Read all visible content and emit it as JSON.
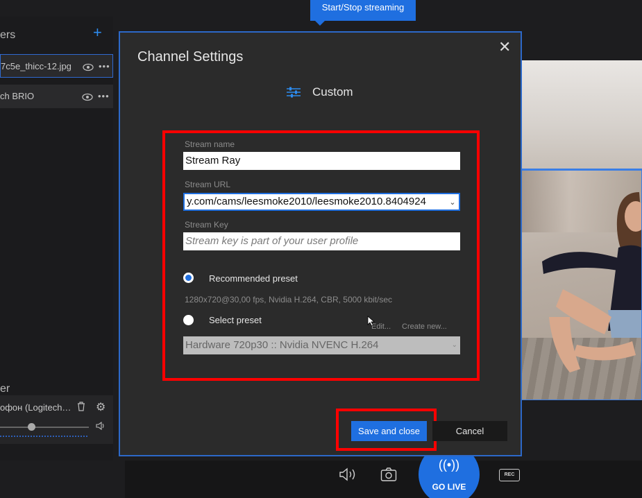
{
  "left_panel": {
    "layers_title": "ers",
    "add_icon": "plus-icon",
    "layers": [
      {
        "name": "7c5e_thicc-12.jpg",
        "selected": true
      },
      {
        "name": "ch BRIO",
        "selected": false
      }
    ],
    "mixer_title": "er",
    "mic_label": "офон  (Logitech…"
  },
  "tooltip": "Start/Stop streaming",
  "dialog": {
    "title": "Channel Settings",
    "service_name": "Custom",
    "stream_name_label": "Stream name",
    "stream_name_value": "Stream Ray",
    "stream_url_label": "Stream URL",
    "stream_url_value": "y.com/cams/leesmoke2010/leesmoke2010.8404924",
    "stream_key_label": "Stream Key",
    "stream_key_placeholder": "Stream key is part of your user profile",
    "recommended_preset_label": "Recommended preset",
    "recommended_preset_info": "1280x720@30,00 fps, Nvidia H.264, CBR, 5000 kbit/sec",
    "select_preset_label": "Select preset",
    "edit_link": "Edit...",
    "create_new_link": "Create new...",
    "preset_value": "Hardware 720p30 :: Nvidia NVENC H.264",
    "save_button": "Save and close",
    "cancel_button": "Cancel"
  },
  "bottom_bar": {
    "go_live_label": "GO LIVE",
    "rec_label": "REC"
  },
  "colors": {
    "accent": "#1f6fe0",
    "highlight": "#ff0000",
    "dialog_bg": "#2b2b2b"
  }
}
